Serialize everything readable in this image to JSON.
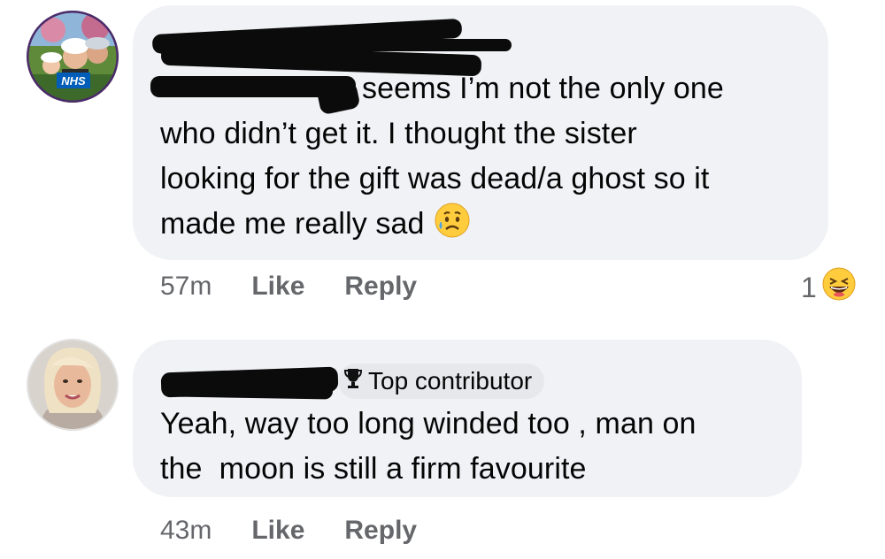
{
  "comments": [
    {
      "author_redacted": true,
      "avatar_badge": "NHS",
      "text_line1": "seems I’m not the only one",
      "text_line2": "who didn’t get it. I thought the sister",
      "text_line3": "looking for the gift was dead/a ghost so it",
      "text_line4": "made me really sad",
      "emoji": "sad-but-relieved-face",
      "time": "57m",
      "like_label": "Like",
      "reply_label": "Reply",
      "reaction_count": "1",
      "reaction_emoji": "grinning-squinting-face"
    },
    {
      "author_redacted": true,
      "badge_label": "Top contributor",
      "badge_icon": "trophy-icon",
      "text_line1": "Yeah, way too long winded too , man on",
      "text_line2": "the  moon is still a firm favourite",
      "time": "43m",
      "like_label": "Like",
      "reply_label": "Reply"
    }
  ],
  "colors": {
    "bubble": "#f0f2f5",
    "meta_text": "#65676b",
    "text": "#050505",
    "nhs_blue": "#005eb8"
  }
}
